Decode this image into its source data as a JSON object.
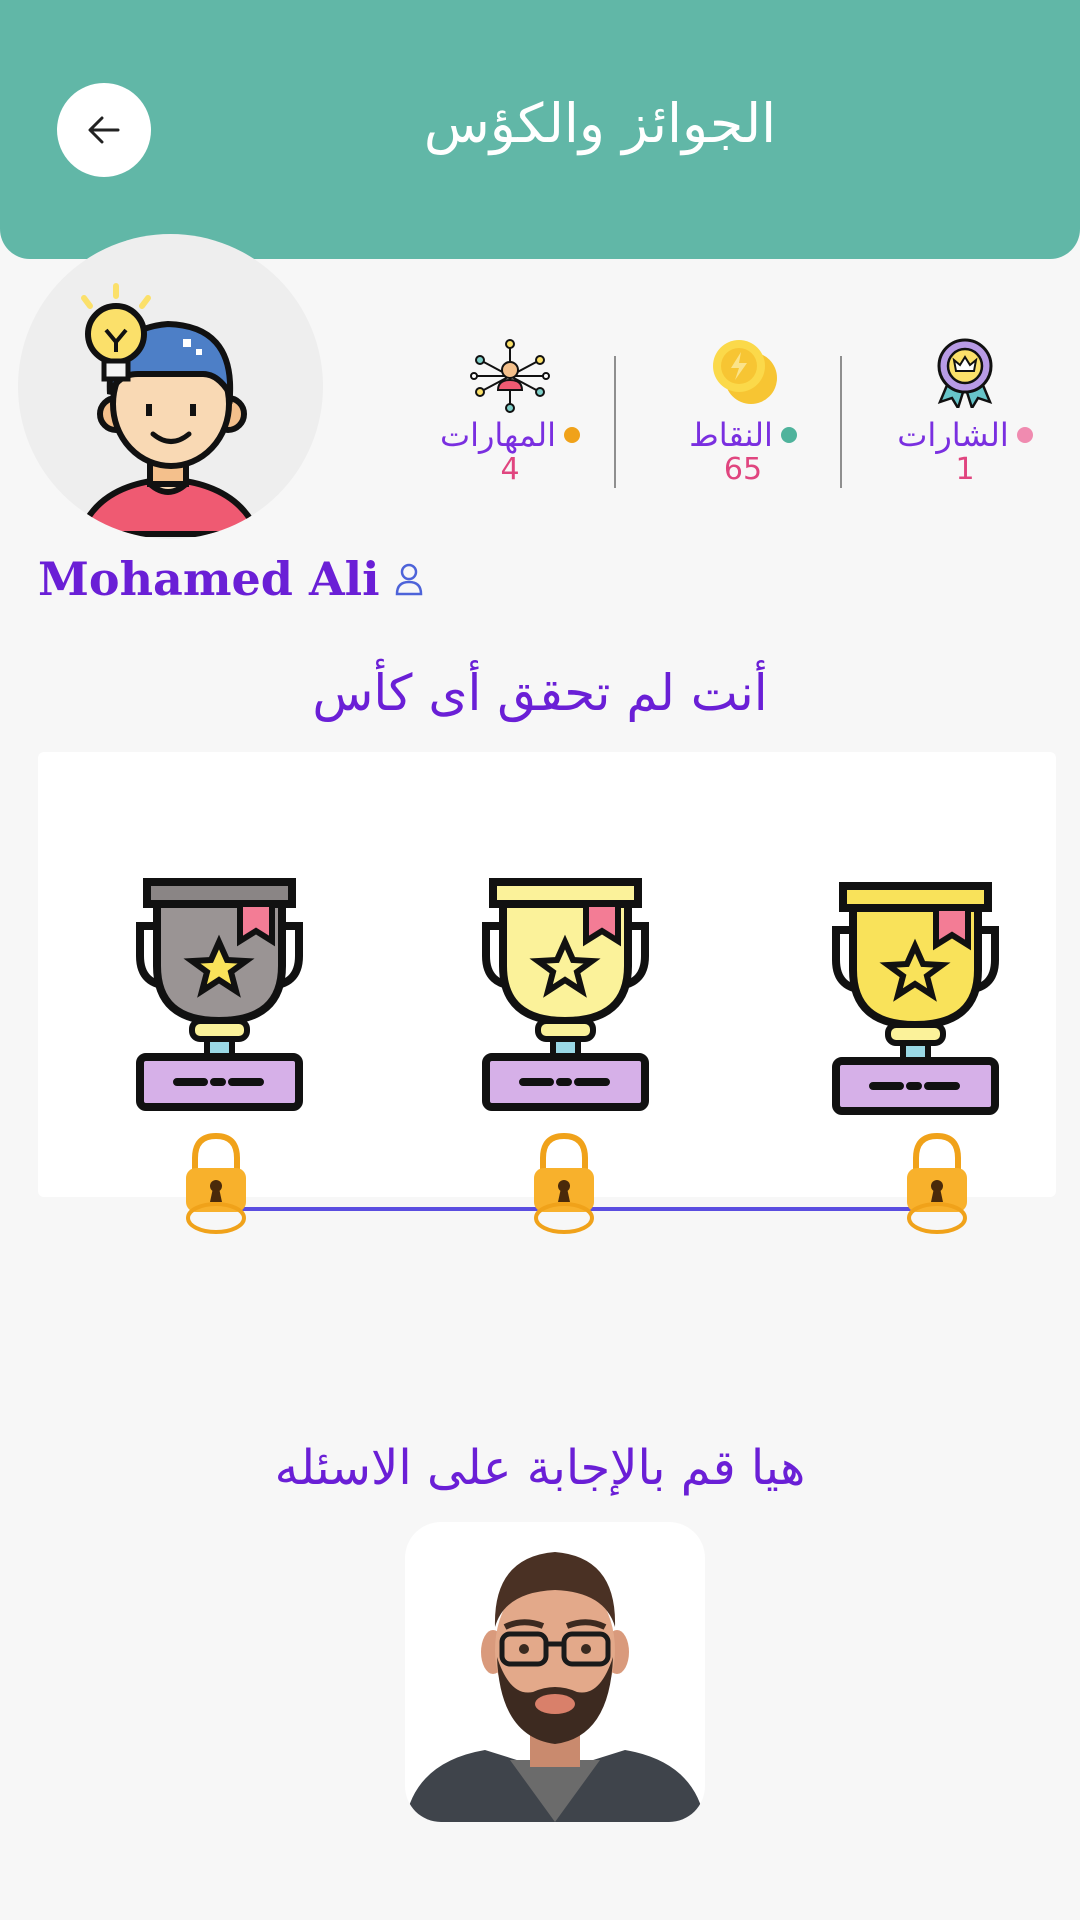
{
  "header": {
    "title": "الجوائز والكؤس",
    "back_icon": "arrow-left-icon"
  },
  "user": {
    "name": "Mohamed Ali",
    "avatar_icon": "boy-idea-avatar-icon",
    "profile_icon": "user-outline-icon"
  },
  "stats": [
    {
      "label": "الشارات",
      "value": "1",
      "icon": "badge-medal-icon",
      "dot_color": "#f08bb0"
    },
    {
      "label": "النقاط",
      "value": "65",
      "icon": "coins-icon",
      "dot_color": "#4fb39c"
    },
    {
      "label": "المهارات",
      "value": "4",
      "icon": "skills-network-icon",
      "dot_color": "#f0a21a"
    }
  ],
  "status_message": "أنت لم تحقق أى كأس",
  "trophies": [
    {
      "name": "gold",
      "cup_color": "#f9e25a",
      "locked": true
    },
    {
      "name": "light-gold",
      "cup_color": "#fbf29a",
      "locked": true
    },
    {
      "name": "silver",
      "cup_color": "#9a9494",
      "locked": true
    }
  ],
  "cta_text": "هيا قم بالإجابة على الاسئله",
  "assistant_icon": "bearded-man-avatar-icon",
  "colors": {
    "header": "#61b7a7",
    "accent": "#6a1fd6",
    "value": "#e0457f",
    "line": "#5a4de0"
  }
}
